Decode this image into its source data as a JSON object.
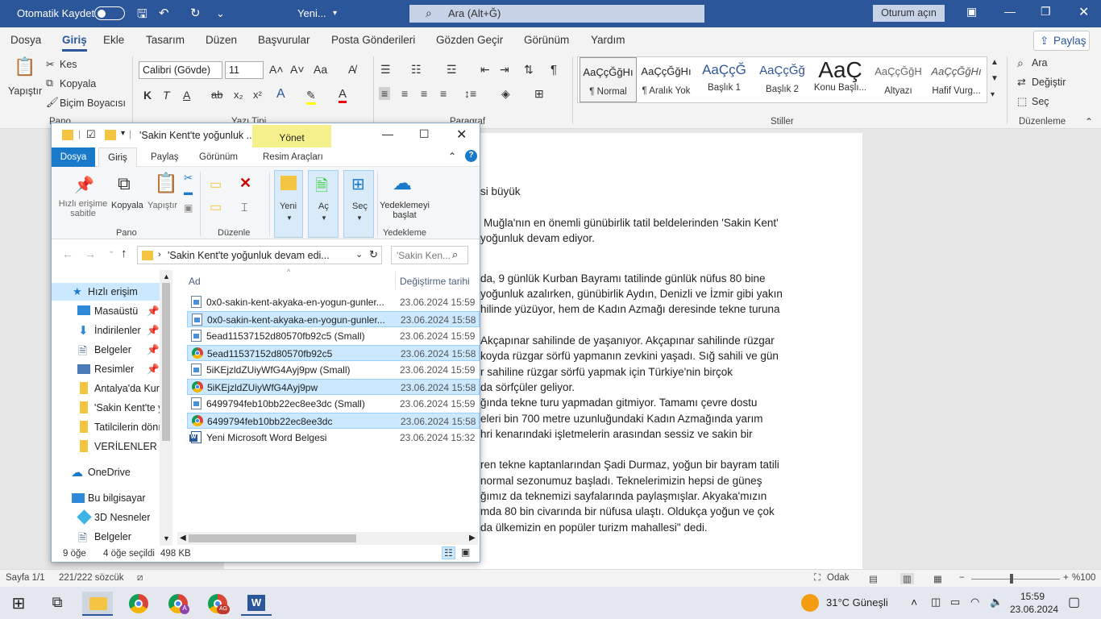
{
  "word": {
    "autosave": "Otomatik Kaydet",
    "doc_title": "Yeni...",
    "search": "Ara (Alt+Ğ)",
    "signin": "Oturum açın",
    "menu": [
      "Dosya",
      "Giriş",
      "Ekle",
      "Tasarım",
      "Düzen",
      "Başvurular",
      "Posta Gönderileri",
      "Gözden Geçir",
      "Görünüm",
      "Yardım"
    ],
    "share": "Paylaş",
    "clipboard": {
      "paste": "Yapıştır",
      "cut": "Kes",
      "copy": "Kopyala",
      "format": "Biçim Boyacısı",
      "group": "Pano"
    },
    "font": {
      "name": "Calibri (Gövde)",
      "size": "11",
      "group": "Yazı Tipi"
    },
    "paragraph_group": "Paragraf",
    "styles": [
      {
        "preview": "AaÇçĞğHı",
        "name": "¶ Normal"
      },
      {
        "preview": "AaÇçĞğHı",
        "name": "¶ Aralık Yok"
      },
      {
        "preview": "AaÇçĞ",
        "name": "Başlık 1"
      },
      {
        "preview": "AaÇçĞğ",
        "name": "Başlık 2"
      },
      {
        "preview": "AaÇ",
        "name": "Konu Başlı..."
      },
      {
        "preview": "AaÇçĞğH",
        "name": "Altyazı"
      },
      {
        "preview": "AaÇçĞğHı",
        "name": "Hafif Vurg..."
      }
    ],
    "styles_group": "Stiller",
    "editing": {
      "find": "Ara",
      "replace": "Değiştir",
      "select": "Seç",
      "group": "Düzenleme"
    },
    "doc_lines": [
      "si büyük",
      "Muğla'nın en önemli günübirlik tatil beldelerinden 'Sakin Kent'",
      "yoğunluk devam ediyor.",
      "da, 9 günlük Kurban Bayramı tatilinde günlük nüfus 80 bine",
      "yoğunluk azalırken, günübirlik Aydın, Denizli ve İzmir gibi yakın",
      "hilinde yüzüyor, hem de Kadın Azmağı deresinde tekne turuna",
      "Akçapınar sahilinde de yaşanıyor. Akçapınar sahilinde rüzgar",
      "koyda rüzgar sörfü yapmanın zevkini yaşadı. Sığ sahili ve gün",
      "r sahiline rüzgar sörfü yapmak için Türkiye'nin birçok",
      "da sörfçüler geliyor.",
      "ğında tekne turu yapmadan gitmiyor. Tamamı çevre dostu",
      "eleri bin 700 metre uzunluğundaki Kadın Azmağında yarım",
      "hri kenarındaki işletmelerin arasından sessiz ve sakin bir",
      "ren tekne kaptanlarından Şadi Durmaz, yoğun bir bayram tatili",
      "normal sezonumuz başladı. Teknelerimizin hepsi de güneş",
      "ğımız da teknemizi sayfalarında paylaşmışlar. Akyaka'mızın",
      "mda 80 bin civarında bir nüfusa ulaştı. Oldukça yoğun ve çok",
      "da ülkemizin en popüler turizm mahallesi\" dedi."
    ],
    "status": {
      "page": "Sayfa 1/1",
      "words": "221/222 sözcük",
      "focus": "Odak",
      "zoom": "%100"
    }
  },
  "explorer": {
    "title": "'Sakin Kent'te yoğunluk ...",
    "manage": "Yönet",
    "tabs": [
      "Dosya",
      "Giriş",
      "Paylaş",
      "Görünüm",
      "Resim Araçları"
    ],
    "ribbon": {
      "pin": "Hızlı erişime sabitle",
      "copy": "Kopyala",
      "paste": "Yapıştır",
      "pano": "Pano",
      "organize": "Düzenle",
      "new": "Yeni",
      "open": "Aç",
      "select": "Seç",
      "backup": "Yedeklemeyi başlat",
      "backup_group": "Yedekleme"
    },
    "address": "'Sakin Kent'te yoğunluk devam edi...",
    "search": "'Sakin Ken...",
    "nav": [
      {
        "label": "Hızlı erişim",
        "icon": "star-icon"
      },
      {
        "label": "Masaüstü",
        "icon": "desktop-icon",
        "pin": true
      },
      {
        "label": "İndirilenler",
        "icon": "download-icon",
        "pin": true
      },
      {
        "label": "Belgeler",
        "icon": "documents-icon",
        "pin": true
      },
      {
        "label": "Resimler",
        "icon": "pictures-icon",
        "pin": true
      },
      {
        "label": "Antalya'da Kurl",
        "icon": "folder-icon"
      },
      {
        "label": "'Sakin Kent'te y",
        "icon": "folder-icon"
      },
      {
        "label": "Tatilcilerin dönı",
        "icon": "folder-icon"
      },
      {
        "label": "VERİLENLER",
        "icon": "folder-icon"
      },
      {
        "label": "OneDrive",
        "icon": "cloud-icon"
      },
      {
        "label": "Bu bilgisayar",
        "icon": "computer-icon"
      },
      {
        "label": "3D Nesneler",
        "icon": "cube-icon"
      },
      {
        "label": "Belgeler",
        "icon": "documents-icon"
      }
    ],
    "columns": {
      "name": "Ad",
      "date": "Değiştirme tarihi"
    },
    "files": [
      {
        "name": "0x0-sakin-kent-akyaka-en-yogun-gunler...",
        "date": "23.06.2024 15:59",
        "icon": "image-file-icon",
        "selected": false
      },
      {
        "name": "0x0-sakin-kent-akyaka-en-yogun-gunler...",
        "date": "23.06.2024 15:58",
        "icon": "image-file-icon",
        "selected": true
      },
      {
        "name": "5ead11537152d80570fb92c5 (Small)",
        "date": "23.06.2024 15:59",
        "icon": "image-file-icon",
        "selected": false
      },
      {
        "name": "5ead11537152d80570fb92c5",
        "date": "23.06.2024 15:58",
        "icon": "chrome-icon",
        "selected": true
      },
      {
        "name": "5iKEjzldZUiyWfG4Ayj9pw (Small)",
        "date": "23.06.2024 15:59",
        "icon": "image-file-icon",
        "selected": false
      },
      {
        "name": "5iKEjzldZUiyWfG4Ayj9pw",
        "date": "23.06.2024 15:58",
        "icon": "chrome-icon",
        "selected": true
      },
      {
        "name": "6499794feb10bb22ec8ee3dc (Small)",
        "date": "23.06.2024 15:59",
        "icon": "image-file-icon",
        "selected": false
      },
      {
        "name": "6499794feb10bb22ec8ee3dc",
        "date": "23.06.2024 15:58",
        "icon": "chrome-icon",
        "selected": true
      },
      {
        "name": "Yeni Microsoft Word Belgesi",
        "date": "23.06.2024 15:32",
        "icon": "word-file-icon",
        "selected": false
      }
    ],
    "status": {
      "count": "9 öğe",
      "selected": "4 öğe seçildi",
      "size": "498 KB"
    }
  },
  "taskbar": {
    "weather": "31°C  Güneşli",
    "time": "15:59",
    "date": "23.06.2024"
  },
  "colors": {
    "word_blue": "#2b579a",
    "selection": "#cce8ff",
    "manage_yellow": "#f5f08b"
  }
}
